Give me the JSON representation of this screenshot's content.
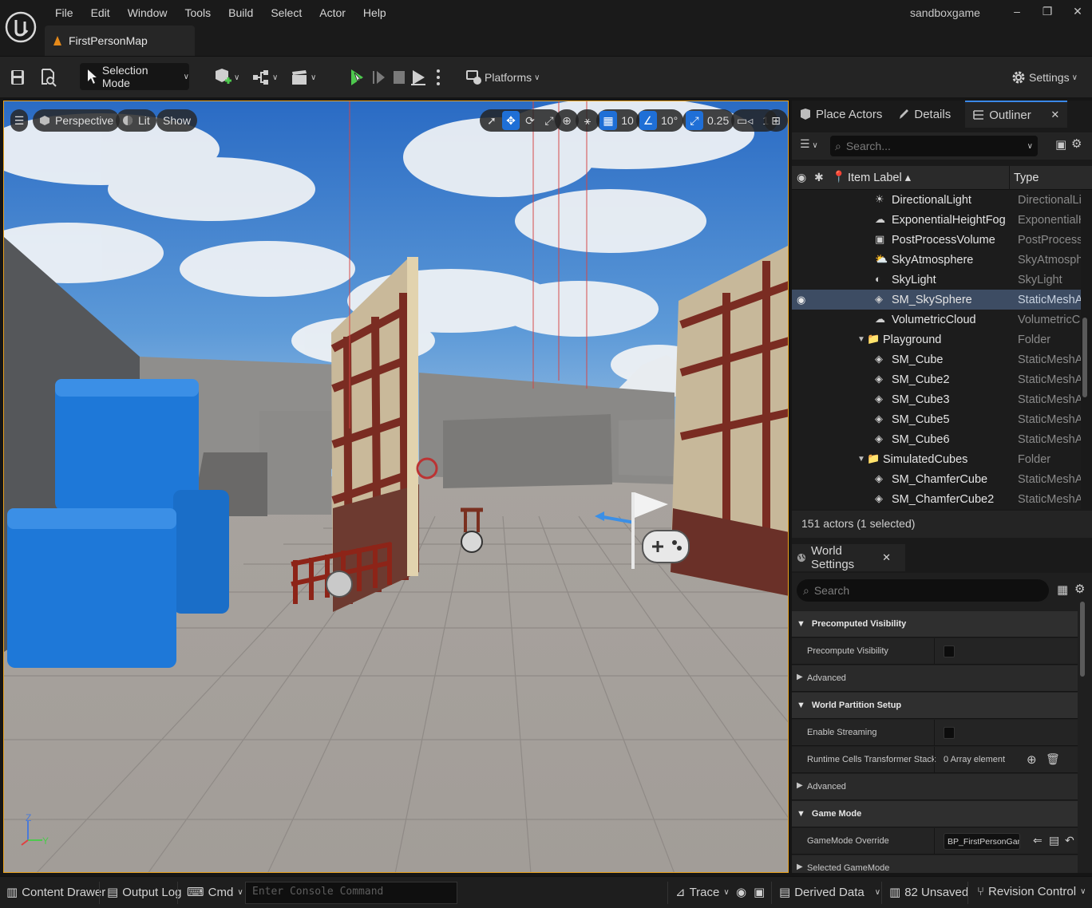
{
  "menu": [
    "File",
    "Edit",
    "Window",
    "Tools",
    "Build",
    "Select",
    "Actor",
    "Help"
  ],
  "map_tab": "FirstPersonMap",
  "project_name": "sandboxgame",
  "window_controls": [
    "–",
    "❐",
    "✕"
  ],
  "toolbar": {
    "selection_mode": "Selection Mode",
    "platforms": "Platforms",
    "settings": "Settings"
  },
  "viewport": {
    "perspective": "Perspective",
    "lit": "Lit",
    "show": "Show",
    "grid_snap": "10",
    "rotation_snap": "10°",
    "scale_snap": "0.25",
    "camera_speed": "1",
    "axis_labels": [
      "Z",
      "Y"
    ]
  },
  "right_tabs": [
    "Place Actors",
    "Details",
    "Outliner"
  ],
  "outliner": {
    "search_placeholder": "Search...",
    "col_label": "Item Label ▴",
    "col_type": "Type",
    "rows": [
      {
        "name": "DirectionalLight",
        "type": "DirectionalLigl",
        "icon": "directional-light-icon",
        "indent": 1
      },
      {
        "name": "ExponentialHeightFog",
        "type": "ExponentialHe",
        "icon": "fog-icon",
        "indent": 1
      },
      {
        "name": "PostProcessVolume",
        "type": "PostProcessV",
        "icon": "post-process-icon",
        "indent": 1
      },
      {
        "name": "SkyAtmosphere",
        "type": "SkyAtmospher",
        "icon": "sky-atmosphere-icon",
        "indent": 1
      },
      {
        "name": "SkyLight",
        "type": "SkyLight",
        "icon": "sky-light-icon",
        "indent": 1
      },
      {
        "name": "SM_SkySphere",
        "type": "StaticMeshAct",
        "icon": "static-mesh-icon",
        "indent": 1,
        "selected": true
      },
      {
        "name": "VolumetricCloud",
        "type": "VolumetricClo",
        "icon": "cloud-icon",
        "indent": 1
      },
      {
        "name": "Playground",
        "type": "Folder",
        "icon": "folder-icon",
        "indent": 0,
        "folder": true
      },
      {
        "name": "SM_Cube",
        "type": "StaticMeshAct",
        "icon": "static-mesh-icon",
        "indent": 1
      },
      {
        "name": "SM_Cube2",
        "type": "StaticMeshAct",
        "icon": "static-mesh-icon",
        "indent": 1
      },
      {
        "name": "SM_Cube3",
        "type": "StaticMeshAct",
        "icon": "static-mesh-icon",
        "indent": 1
      },
      {
        "name": "SM_Cube5",
        "type": "StaticMeshAct",
        "icon": "static-mesh-icon",
        "indent": 1
      },
      {
        "name": "SM_Cube6",
        "type": "StaticMeshAct",
        "icon": "static-mesh-icon",
        "indent": 1
      },
      {
        "name": "SimulatedCubes",
        "type": "Folder",
        "icon": "folder-icon",
        "indent": 0,
        "folder": true
      },
      {
        "name": "SM_ChamferCube",
        "type": "StaticMeshAct",
        "icon": "static-mesh-icon",
        "indent": 1
      },
      {
        "name": "SM_ChamferCube2",
        "type": "StaticMeshAct",
        "icon": "static-mesh-icon",
        "indent": 1
      }
    ],
    "actor_count": "151 actors (1 selected)"
  },
  "world_settings": {
    "tab": "World Settings",
    "search_placeholder": "Search",
    "cat_precomputed": "Precomputed Visibility",
    "precompute_visibility": "Precompute Visibility",
    "advanced_1": "Advanced",
    "cat_world_partition": "World Partition Setup",
    "enable_streaming": "Enable Streaming",
    "runtime_cells": "Runtime Cells Transformer Stack",
    "array_elements": "0 Array element",
    "advanced_2": "Advanced",
    "cat_game_mode": "Game Mode",
    "gamemode_override": "GameMode Override",
    "gamemode_value": "BP_FirstPersonGan",
    "selected_gamemode": "Selected GameMode"
  },
  "statusbar": {
    "content_drawer": "Content Drawer",
    "output_log": "Output Log",
    "cmd": "Cmd",
    "console_placeholder": "Enter Console Command",
    "trace": "Trace",
    "derived_data": "Derived Data",
    "unsaved": "82 Unsaved",
    "revision_control": "Revision Control"
  },
  "colors": {
    "accent": "#1f6fd6",
    "viewport_border": "#e9a21e",
    "selection": "#3d4c63",
    "cube": "#1e78d8"
  }
}
